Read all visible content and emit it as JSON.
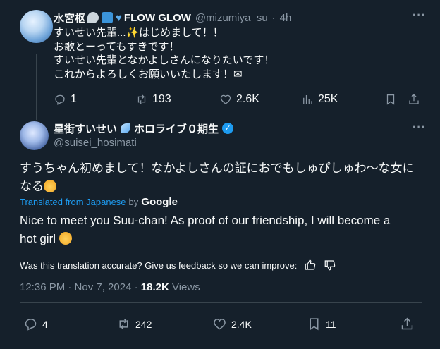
{
  "tweet1": {
    "display_name": "水宮枢",
    "display_name_suffix": "FLOW GLOW",
    "handle": "@mizumiya_su",
    "separator": "·",
    "time": "4h",
    "lines": [
      "すいせい先輩...✨はじめまして！！",
      "お歌とーってもすきです！",
      "すいせい先輩となかよしさんになりたいです！",
      "これからよろしくお願いいたします！✉"
    ],
    "actions": {
      "replies": "1",
      "reposts": "193",
      "likes": "2.6K",
      "views": "25K"
    }
  },
  "tweet2": {
    "display_name": "星街すいせい",
    "display_name_suffix": "ホロライブ０期生",
    "verified_mark": "✓",
    "handle": "@suisei_hosimati",
    "text_line1": "すうちゃん初めまして！なかよしさんの証におでもしゅぴしゅわ〜な女に",
    "text_line2": "なる",
    "translated_label": "Translated from Japanese",
    "translated_by": "by",
    "translator": "Google",
    "translation_line1": "Nice to meet you Suu-chan! As proof of our friendship, I will become a",
    "translation_line2": "hot girl",
    "feedback": "Was this translation accurate? Give us feedback so we can improve:",
    "timestamp": "12:36 PM · Nov 7, 2024 ·",
    "views_count": "18.2K",
    "views_label": "Views",
    "actions": {
      "replies": "4",
      "reposts": "242",
      "likes": "2.4K",
      "bookmarks": "11"
    }
  },
  "more_glyph": "···"
}
